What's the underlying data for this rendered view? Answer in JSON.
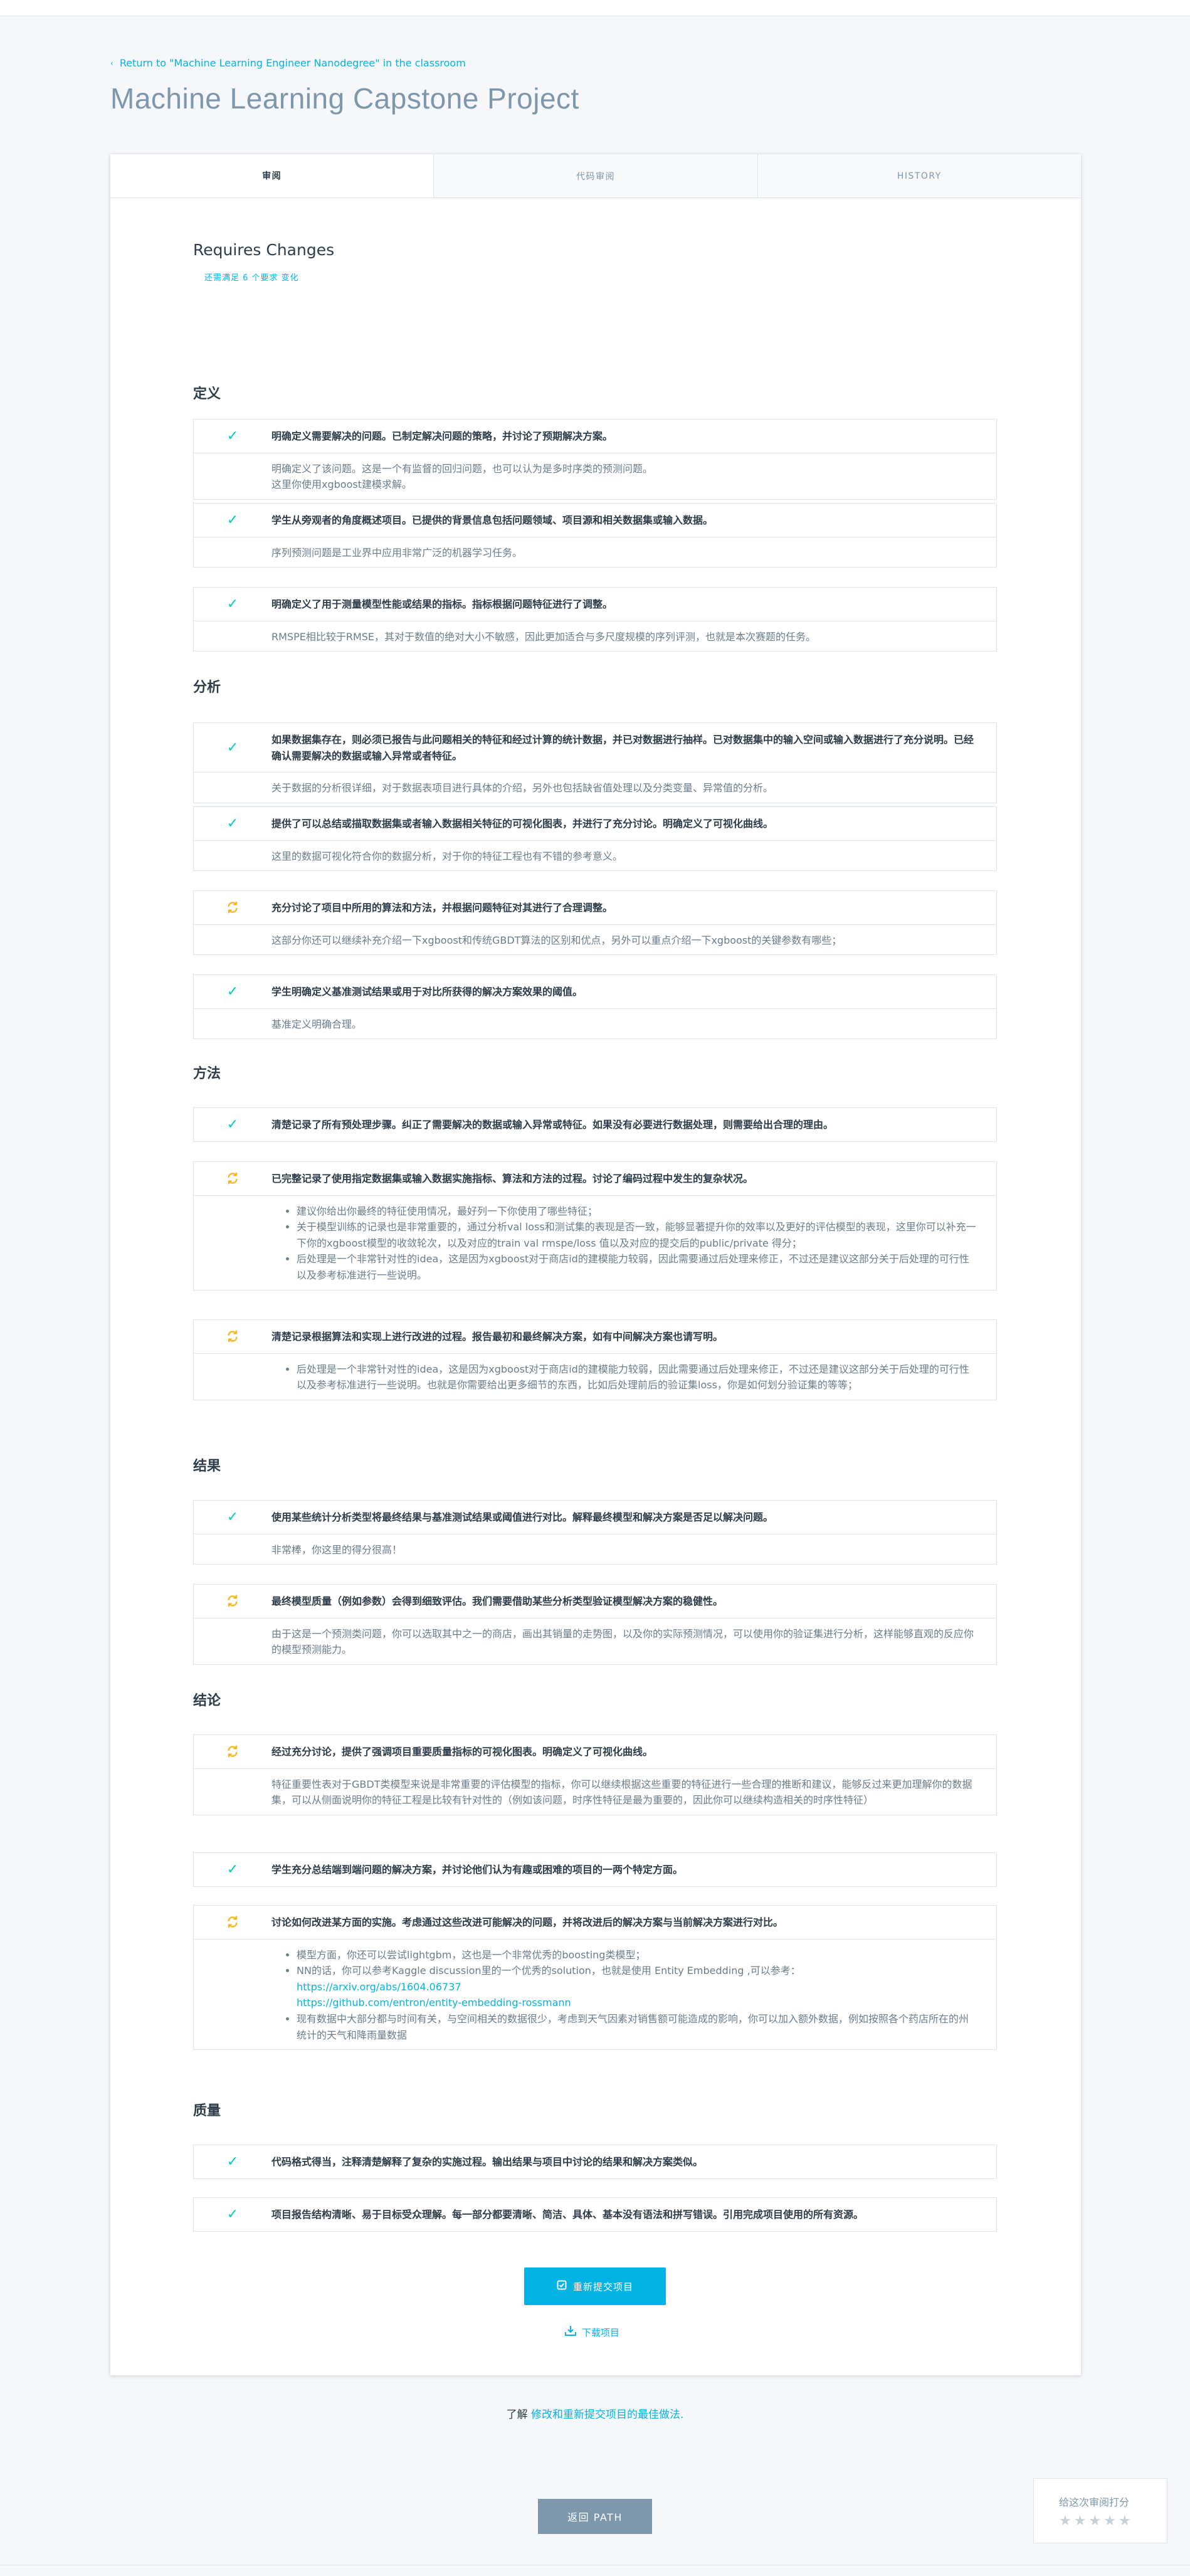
{
  "header": {
    "back_link": "Return to \"Machine Learning Engineer Nanodegree\" in the classroom",
    "title": "Machine Learning Capstone Project"
  },
  "tabs": [
    {
      "label": "审阅",
      "active": true
    },
    {
      "label": "代码审阅",
      "active": false
    },
    {
      "label": "HISTORY",
      "active": false
    }
  ],
  "status": {
    "title": "Requires Changes",
    "subtitle": "还需满足 6 个要求 变化"
  },
  "colors": {
    "accent": "#02b3e4",
    "pass": "#02ccba",
    "fail": "#f8b524",
    "muted_button": "#7d97ad"
  },
  "sections": [
    {
      "title": "定义",
      "items": [
        {
          "status": "pass",
          "title": "明确定义需要解决的问题。已制定解决问题的策略，并讨论了预期解决方案。",
          "comment": [
            "明确定义了该问题。这是一个有监督的回归问题，也可以认为是多时序类的预测问题。",
            "这里你使用xgboost建模求解。"
          ]
        },
        {
          "status": "pass",
          "title": "学生从旁观者的角度概述项目。已提供的背景信息包括问题领域、项目源和相关数据集或输入数据。",
          "comment": [
            "序列预测问题是工业界中应用非常广泛的机器学习任务。"
          ]
        },
        {
          "status": "pass",
          "title": "明确定义了用于测量模型性能或结果的指标。指标根据问题特征进行了调整。",
          "comment": [
            "RMSPE相比较于RMSE，其对于数值的绝对大小不敏感，因此更加适合与多尺度规模的序列评测，也就是本次赛题的任务。"
          ]
        }
      ]
    },
    {
      "title": "分析",
      "items": [
        {
          "status": "pass",
          "title": "如果数据集存在，则必须已报告与此问题相关的特征和经过计算的统计数据，并已对数据进行抽样。已对数据集中的输入空间或输入数据进行了充分说明。已经确认需要解决的数据或输入异常或者特征。",
          "comment": [
            "关于数据的分析很详细，对于数据表项目进行具体的介绍，另外也包括缺省值处理以及分类变量、异常值的分析。"
          ]
        },
        {
          "status": "pass",
          "title": "提供了可以总结或描取数据集或者输入数据相关特征的可视化图表，并进行了充分讨论。明确定义了可视化曲线。",
          "comment": [
            "这里的数据可视化符合你的数据分析，对于你的特征工程也有不错的参考意义。"
          ]
        },
        {
          "status": "fail",
          "title": "充分讨论了项目中所用的算法和方法，并根据问题特征对其进行了合理调整。",
          "comment": [
            "这部分你还可以继续补充介绍一下xgboost和传统GBDT算法的区别和优点，另外可以重点介绍一下xgboost的关键参数有哪些；"
          ]
        },
        {
          "status": "pass",
          "title": "学生明确定义基准测试结果或用于对比所获得的解决方案效果的阈值。",
          "comment": [
            "基准定义明确合理。"
          ]
        }
      ]
    },
    {
      "title": "方法",
      "items": [
        {
          "status": "pass",
          "title": "清楚记录了所有预处理步骤。纠正了需要解决的数据或输入异常或特征。如果没有必要进行数据处理，则需要给出合理的理由。",
          "comment": []
        },
        {
          "status": "fail",
          "title": "已完整记录了使用指定数据集或输入数据实施指标、算法和方法的过程。讨论了编码过程中发生的复杂状况。",
          "bullets": [
            "建议你给出你最终的特征使用情况，最好列一下你使用了哪些特征；",
            "关于模型训练的记录也是非常重要的，通过分析val loss和测试集的表现是否一致，能够显著提升你的效率以及更好的评估模型的表现，这里你可以补充一下你的xgboost模型的收敛轮次，以及对应的train val rmspe/loss 值以及对应的提交后的public/private 得分；",
            "后处理是一个非常针对性的idea，这是因为xgboost对于商店id的建模能力较弱，因此需要通过后处理来修正，不过还是建议这部分关于后处理的可行性以及参考标准进行一些说明。"
          ]
        },
        {
          "status": "fail",
          "title": "清楚记录根据算法和实现上进行改进的过程。报告最初和最终解决方案，如有中间解决方案也请写明。",
          "bullets": [
            "后处理是一个非常针对性的idea，这是因为xgboost对于商店id的建模能力较弱，因此需要通过后处理来修正，不过还是建议这部分关于后处理的可行性以及参考标准进行一些说明。也就是你需要给出更多细节的东西，比如后处理前后的验证集loss，你是如何划分验证集的等等；"
          ]
        }
      ]
    },
    {
      "title": "结果",
      "items": [
        {
          "status": "pass",
          "title": "使用某些统计分析类型将最终结果与基准测试结果或阈值进行对比。解释最终模型和解决方案是否足以解决问题。",
          "comment": [
            "非常棒，你这里的得分很高！"
          ]
        },
        {
          "status": "fail",
          "title": "最终模型质量（例如参数）会得到细致评估。我们需要借助某些分析类型验证模型解决方案的稳健性。",
          "comment": [
            "由于这是一个预测类问题，你可以选取其中之一的商店，画出其销量的走势图，以及你的实际预测情况，可以使用你的验证集进行分析，这样能够直观的反应你的模型预测能力。"
          ]
        }
      ]
    },
    {
      "title": "结论",
      "items": [
        {
          "status": "fail",
          "title": "经过充分讨论，提供了强调项目重要质量指标的可视化图表。明确定义了可视化曲线。",
          "comment": [
            "特征重要性表对于GBDT类模型来说是非常重要的评估模型的指标，你可以继续根据这些重要的特征进行一些合理的推断和建议，能够反过来更加理解你的数据集，可以从侧面说明你的特征工程是比较有针对性的（例如该问题，时序性特征是最为重要的，因此你可以继续构造相关的时序性特征）"
          ]
        },
        {
          "status": "pass",
          "title": "学生充分总结端到端问题的解决方案，并讨论他们认为有趣或困难的项目的一两个特定方面。",
          "comment": []
        },
        {
          "status": "fail",
          "title": "讨论如何改进某方面的实施。考虑通过这些改进可能解决的问题，并将改进后的解决方案与当前解决方案进行对比。",
          "bullets": [
            "模型方面，你还可以尝试lightgbm，这也是一个非常优秀的boosting类模型；",
            "NN的话，你可以参考Kaggle discussion里的一个优秀的solution，也就是使用 Entity Embedding ,可以参考：",
            "现有数据中大部分都与时间有关，与空间相关的数据很少，考虑到天气因素对销售额可能造成的影响，你可以加入额外数据，例如按照各个药店所在的州统计的天气和降雨量数据"
          ],
          "links": [
            "https://arxiv.org/abs/1604.06737",
            "https://github.com/entron/entity-embedding-rossmann"
          ]
        }
      ]
    },
    {
      "title": "质量",
      "items": [
        {
          "status": "pass",
          "title": "代码格式得当，注释清楚解释了复杂的实施过程。输出结果与项目中讨论的结果和解决方案类似。",
          "comment": []
        },
        {
          "status": "pass",
          "title": "项目报告结构清晰、易于目标受众理解。每一部分都要清晰、简洁、具体、基本没有语法和拼写错误。引用完成项目使用的所有资源。",
          "comment": []
        }
      ]
    }
  ],
  "actions": {
    "resubmit_label": "重新提交项目",
    "download_label": "下载项目",
    "learn_prefix": "了解",
    "learn_link": "修改和重新提交项目的最佳做法.",
    "path_label": "返回 PATH"
  },
  "rating": {
    "label": "给这次审阅打分",
    "stars": 5
  }
}
